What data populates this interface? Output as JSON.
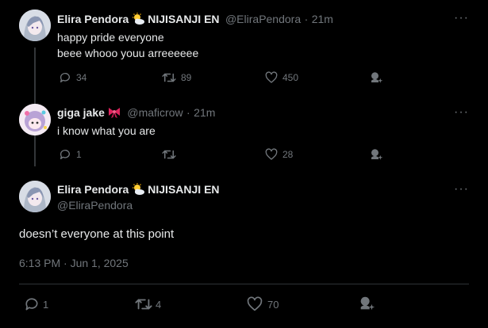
{
  "tweet1": {
    "display_name": "Elira Pendora",
    "affiliation": "NIJISANJI EN",
    "handle": "@EliraPendora",
    "sep": "·",
    "time": "21m",
    "lines": [
      "happy pride everyone",
      "beee whooo youu arreeeeee"
    ],
    "replies": "34",
    "reposts": "89",
    "likes": "450"
  },
  "tweet2": {
    "display_name": "giga jake",
    "handle": "@maficrow",
    "sep": "·",
    "time": "21m",
    "lines": [
      "i know what you are"
    ],
    "replies": "1",
    "reposts": "",
    "likes": "28"
  },
  "focused": {
    "display_name": "Elira Pendora",
    "affiliation": "NIJISANJI EN",
    "handle": "@EliraPendora",
    "text": "doesn’t everyone at this point",
    "timestamp": "6:13 PM · Jun 1, 2025",
    "replies": "1",
    "reposts": "4",
    "likes": "70"
  },
  "more_glyph": "···",
  "icons": {
    "name_badge_1": "sun-behind-cloud-icon",
    "name_badge_2": "ribbon-bow-icon",
    "reply": "speech-bubble-icon",
    "repost": "repost-arrows-icon",
    "like": "heart-outline-icon",
    "grok": "grok-sparkle-icon"
  },
  "colors": {
    "background": "#000000",
    "text": "#e7e9ea",
    "muted": "#71767b",
    "divider": "#2f3336",
    "bow": "#e0245e"
  }
}
